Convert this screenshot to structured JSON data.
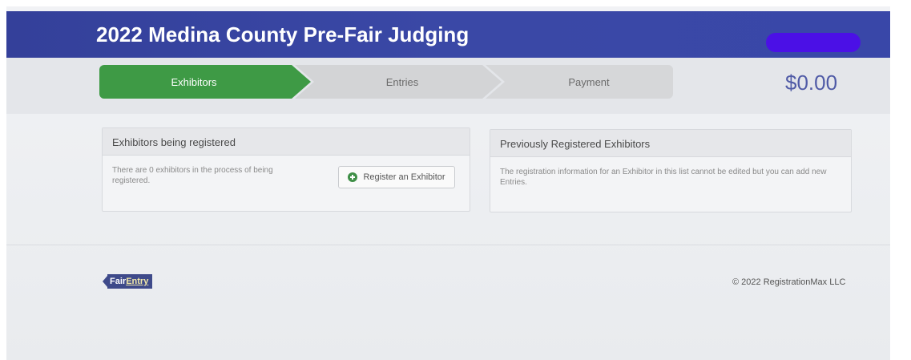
{
  "header": {
    "title": "2022 Medina County Pre-Fair Judging"
  },
  "steps": [
    {
      "label": "Exhibitors",
      "active": true
    },
    {
      "label": "Entries",
      "active": false
    },
    {
      "label": "Payment",
      "active": false
    }
  ],
  "cart": {
    "total": "$0.00"
  },
  "panels": {
    "registering": {
      "title": "Exhibitors being registered",
      "text": "There are 0 exhibitors in the process of being registered.",
      "button_label": "Register an Exhibitor",
      "button_icon": "plus-circle-icon"
    },
    "previous": {
      "title": "Previously Registered Exhibitors",
      "text": "The registration information for an Exhibitor in this list cannot be edited but you can add new Entries."
    }
  },
  "footer": {
    "logo_text_1": "Fair",
    "logo_text_2": "Entry",
    "copyright": "© 2022 RegistrationMax LLC"
  },
  "colors": {
    "header_bg": "#3a48a6",
    "active_step": "#3e9a45",
    "total_text": "#4f5aa6"
  }
}
